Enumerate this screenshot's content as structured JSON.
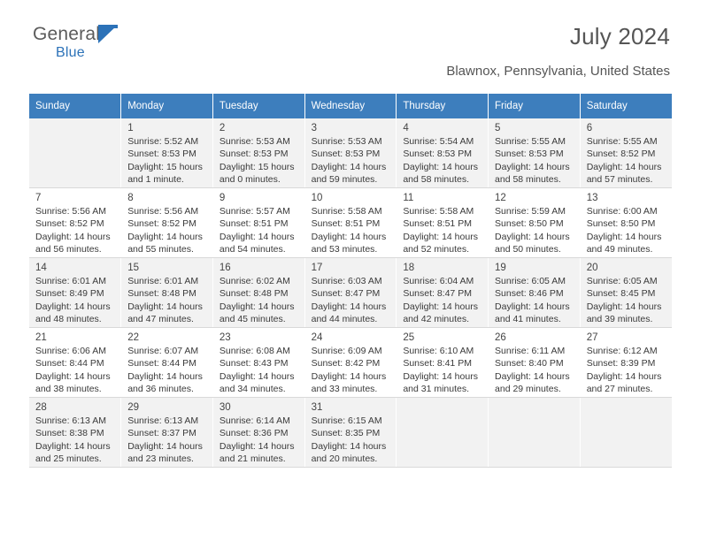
{
  "brand": {
    "name_part1": "General",
    "name_part2": "Blue",
    "flag_icon": "flag-icon"
  },
  "header": {
    "title": "July 2024",
    "location": "Blawnox, Pennsylvania, United States"
  },
  "calendar": {
    "weekday_headers": [
      "Sunday",
      "Monday",
      "Tuesday",
      "Wednesday",
      "Thursday",
      "Friday",
      "Saturday"
    ],
    "weeks": [
      [
        {
          "day": "",
          "lines": []
        },
        {
          "day": "1",
          "lines": [
            "Sunrise: 5:52 AM",
            "Sunset: 8:53 PM",
            "Daylight: 15 hours",
            "and 1 minute."
          ]
        },
        {
          "day": "2",
          "lines": [
            "Sunrise: 5:53 AM",
            "Sunset: 8:53 PM",
            "Daylight: 15 hours",
            "and 0 minutes."
          ]
        },
        {
          "day": "3",
          "lines": [
            "Sunrise: 5:53 AM",
            "Sunset: 8:53 PM",
            "Daylight: 14 hours",
            "and 59 minutes."
          ]
        },
        {
          "day": "4",
          "lines": [
            "Sunrise: 5:54 AM",
            "Sunset: 8:53 PM",
            "Daylight: 14 hours",
            "and 58 minutes."
          ]
        },
        {
          "day": "5",
          "lines": [
            "Sunrise: 5:55 AM",
            "Sunset: 8:53 PM",
            "Daylight: 14 hours",
            "and 58 minutes."
          ]
        },
        {
          "day": "6",
          "lines": [
            "Sunrise: 5:55 AM",
            "Sunset: 8:52 PM",
            "Daylight: 14 hours",
            "and 57 minutes."
          ]
        }
      ],
      [
        {
          "day": "7",
          "lines": [
            "Sunrise: 5:56 AM",
            "Sunset: 8:52 PM",
            "Daylight: 14 hours",
            "and 56 minutes."
          ]
        },
        {
          "day": "8",
          "lines": [
            "Sunrise: 5:56 AM",
            "Sunset: 8:52 PM",
            "Daylight: 14 hours",
            "and 55 minutes."
          ]
        },
        {
          "day": "9",
          "lines": [
            "Sunrise: 5:57 AM",
            "Sunset: 8:51 PM",
            "Daylight: 14 hours",
            "and 54 minutes."
          ]
        },
        {
          "day": "10",
          "lines": [
            "Sunrise: 5:58 AM",
            "Sunset: 8:51 PM",
            "Daylight: 14 hours",
            "and 53 minutes."
          ]
        },
        {
          "day": "11",
          "lines": [
            "Sunrise: 5:58 AM",
            "Sunset: 8:51 PM",
            "Daylight: 14 hours",
            "and 52 minutes."
          ]
        },
        {
          "day": "12",
          "lines": [
            "Sunrise: 5:59 AM",
            "Sunset: 8:50 PM",
            "Daylight: 14 hours",
            "and 50 minutes."
          ]
        },
        {
          "day": "13",
          "lines": [
            "Sunrise: 6:00 AM",
            "Sunset: 8:50 PM",
            "Daylight: 14 hours",
            "and 49 minutes."
          ]
        }
      ],
      [
        {
          "day": "14",
          "lines": [
            "Sunrise: 6:01 AM",
            "Sunset: 8:49 PM",
            "Daylight: 14 hours",
            "and 48 minutes."
          ]
        },
        {
          "day": "15",
          "lines": [
            "Sunrise: 6:01 AM",
            "Sunset: 8:48 PM",
            "Daylight: 14 hours",
            "and 47 minutes."
          ]
        },
        {
          "day": "16",
          "lines": [
            "Sunrise: 6:02 AM",
            "Sunset: 8:48 PM",
            "Daylight: 14 hours",
            "and 45 minutes."
          ]
        },
        {
          "day": "17",
          "lines": [
            "Sunrise: 6:03 AM",
            "Sunset: 8:47 PM",
            "Daylight: 14 hours",
            "and 44 minutes."
          ]
        },
        {
          "day": "18",
          "lines": [
            "Sunrise: 6:04 AM",
            "Sunset: 8:47 PM",
            "Daylight: 14 hours",
            "and 42 minutes."
          ]
        },
        {
          "day": "19",
          "lines": [
            "Sunrise: 6:05 AM",
            "Sunset: 8:46 PM",
            "Daylight: 14 hours",
            "and 41 minutes."
          ]
        },
        {
          "day": "20",
          "lines": [
            "Sunrise: 6:05 AM",
            "Sunset: 8:45 PM",
            "Daylight: 14 hours",
            "and 39 minutes."
          ]
        }
      ],
      [
        {
          "day": "21",
          "lines": [
            "Sunrise: 6:06 AM",
            "Sunset: 8:44 PM",
            "Daylight: 14 hours",
            "and 38 minutes."
          ]
        },
        {
          "day": "22",
          "lines": [
            "Sunrise: 6:07 AM",
            "Sunset: 8:44 PM",
            "Daylight: 14 hours",
            "and 36 minutes."
          ]
        },
        {
          "day": "23",
          "lines": [
            "Sunrise: 6:08 AM",
            "Sunset: 8:43 PM",
            "Daylight: 14 hours",
            "and 34 minutes."
          ]
        },
        {
          "day": "24",
          "lines": [
            "Sunrise: 6:09 AM",
            "Sunset: 8:42 PM",
            "Daylight: 14 hours",
            "and 33 minutes."
          ]
        },
        {
          "day": "25",
          "lines": [
            "Sunrise: 6:10 AM",
            "Sunset: 8:41 PM",
            "Daylight: 14 hours",
            "and 31 minutes."
          ]
        },
        {
          "day": "26",
          "lines": [
            "Sunrise: 6:11 AM",
            "Sunset: 8:40 PM",
            "Daylight: 14 hours",
            "and 29 minutes."
          ]
        },
        {
          "day": "27",
          "lines": [
            "Sunrise: 6:12 AM",
            "Sunset: 8:39 PM",
            "Daylight: 14 hours",
            "and 27 minutes."
          ]
        }
      ],
      [
        {
          "day": "28",
          "lines": [
            "Sunrise: 6:13 AM",
            "Sunset: 8:38 PM",
            "Daylight: 14 hours",
            "and 25 minutes."
          ]
        },
        {
          "day": "29",
          "lines": [
            "Sunrise: 6:13 AM",
            "Sunset: 8:37 PM",
            "Daylight: 14 hours",
            "and 23 minutes."
          ]
        },
        {
          "day": "30",
          "lines": [
            "Sunrise: 6:14 AM",
            "Sunset: 8:36 PM",
            "Daylight: 14 hours",
            "and 21 minutes."
          ]
        },
        {
          "day": "31",
          "lines": [
            "Sunrise: 6:15 AM",
            "Sunset: 8:35 PM",
            "Daylight: 14 hours",
            "and 20 minutes."
          ]
        },
        {
          "day": "",
          "lines": []
        },
        {
          "day": "",
          "lines": []
        },
        {
          "day": "",
          "lines": []
        }
      ]
    ]
  },
  "colors": {
    "header_blue": "#3d7ebd",
    "brand_blue": "#2c72b8",
    "shaded_row": "#f2f2f2"
  }
}
